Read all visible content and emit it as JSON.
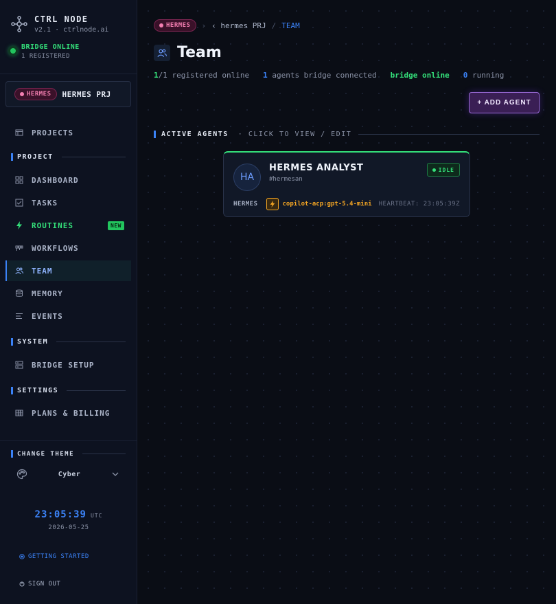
{
  "brand": {
    "name": "CTRL NODE",
    "version": "v2.1 · ctrlnode.ai"
  },
  "bridge": {
    "status": "BRIDGE ONLINE",
    "registered": "1 REGISTERED",
    "color": "#22c55e"
  },
  "project": {
    "tag": "HERMES",
    "name": "HERMES PRJ"
  },
  "nav": {
    "projects": "PROJECTS",
    "project_section": "PROJECT",
    "dashboard": "DASHBOARD",
    "tasks": "TASKS",
    "routines": "ROUTINES",
    "routines_badge": "NEW",
    "workflows": "WORKFLOWS",
    "team": "TEAM",
    "memory": "MEMORY",
    "events": "EVENTS",
    "system_section": "SYSTEM",
    "bridge_setup": "BRIDGE SETUP",
    "settings_section": "SETTINGS",
    "plans_billing": "PLANS & BILLING"
  },
  "theme": {
    "heading": "CHANGE THEME",
    "selected": "Cyber"
  },
  "clock": {
    "time": "23:05:39",
    "tz": "UTC",
    "date": "2026-05-25"
  },
  "links": {
    "getting_started": "GETTING STARTED",
    "sign_out": "SIGN OUT"
  },
  "breadcrumb": {
    "tag": "HERMES",
    "project": "hermes PRJ",
    "current": "TEAM"
  },
  "page": {
    "title": "Team"
  },
  "stats": {
    "online_count": "1",
    "online_rest": "/1 registered online",
    "bridge_count": "1",
    "bridge_rest": "agents bridge connected",
    "bridge_status": "bridge online",
    "running_count": "0",
    "running_rest": "running"
  },
  "add_button": {
    "label": "+ ADD AGENT"
  },
  "list": {
    "title": "ACTIVE AGENTS",
    "hint": "· CLICK TO VIEW / EDIT"
  },
  "agents": [
    {
      "initials": "HA",
      "name": "HERMES ANALYST",
      "handle": "#hermesan",
      "status": "IDLE",
      "owner": "HERMES",
      "model": "copilot-acp:gpt-5.4-mini",
      "heartbeat": "HEARTBEAT: 23:05:39Z"
    }
  ],
  "colors": {
    "accent": "#3b82f6",
    "online": "#34e07a",
    "brand_pink": "#f37fb1",
    "model": "#f5a623",
    "button": "#9b6bd8"
  }
}
